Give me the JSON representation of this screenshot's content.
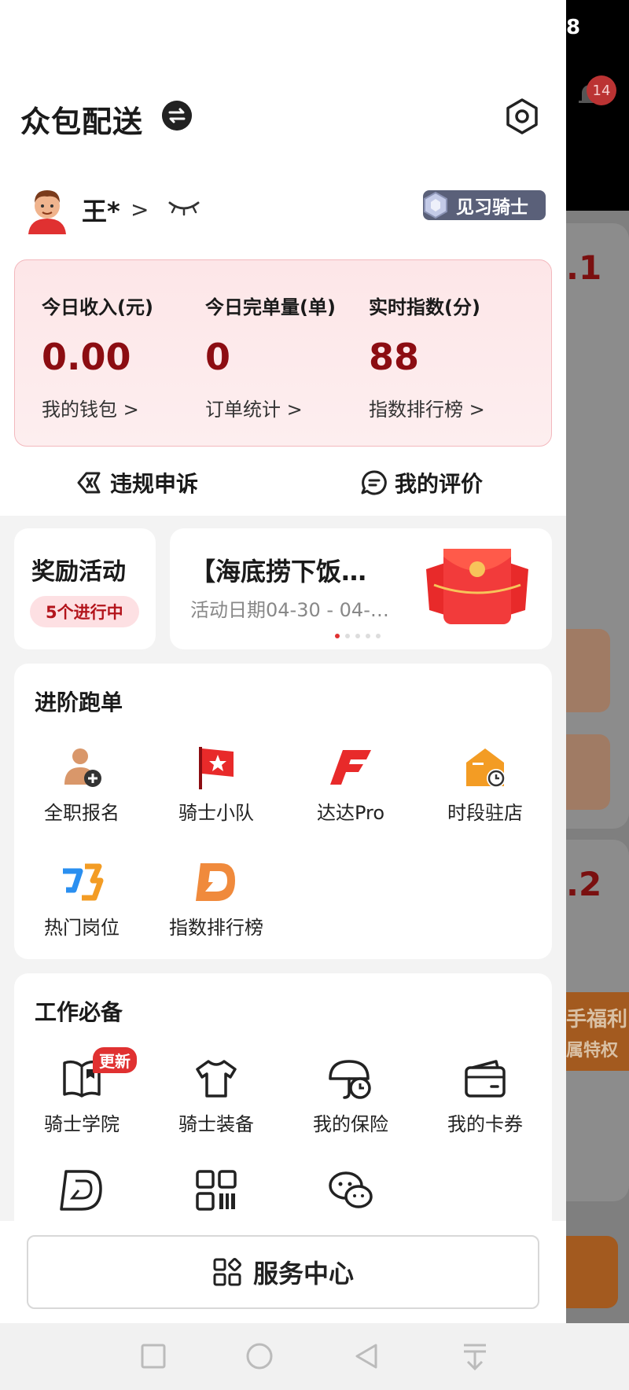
{
  "drawer": {
    "title": "众包配送",
    "user": {
      "name": "王*",
      "chevron": ">",
      "rank": "见习骑士"
    },
    "stats": [
      {
        "label": "今日收入(元)",
        "value": "0.00",
        "link": "我的钱包 >"
      },
      {
        "label": "今日完单量(单)",
        "value": "0",
        "link": "订单统计 >"
      },
      {
        "label": "实时指数(分)",
        "value": "88",
        "link": "指数排行榜 >"
      }
    ],
    "actions": {
      "appeal": "违规申诉",
      "reviews": "我的评价"
    },
    "rewards": {
      "title": "奖励活动",
      "status": "5个进行中"
    },
    "banner": {
      "title": "【海底捞下饭…",
      "date": "活动日期04-30 - 04-…"
    },
    "advanced": {
      "title": "进阶跑单",
      "items": [
        {
          "label": "全职报名",
          "icon": "fulltime-signup-icon"
        },
        {
          "label": "骑士小队",
          "icon": "team-flag-icon"
        },
        {
          "label": "达达Pro",
          "icon": "dada-pro-icon"
        },
        {
          "label": "时段驻店",
          "icon": "store-shift-icon"
        },
        {
          "label": "热门岗位",
          "icon": "hot-jobs-icon"
        },
        {
          "label": "指数排行榜",
          "icon": "index-rank-icon"
        }
      ]
    },
    "essentials": {
      "title": "工作必备",
      "items": [
        {
          "label": "骑士学院",
          "icon": "academy-book-icon",
          "badge": "更新"
        },
        {
          "label": "骑士装备",
          "icon": "tshirt-icon"
        },
        {
          "label": "我的保险",
          "icon": "insurance-umbrella-icon"
        },
        {
          "label": "我的卡券",
          "icon": "wallet-card-icon"
        }
      ]
    },
    "service": {
      "label": "服务中心"
    }
  },
  "background": {
    "status": "8",
    "notifications": "14",
    "value1": ".1",
    "value2": ".2",
    "banner1": "手福利",
    "banner2": "属特权"
  },
  "colors": {
    "primary": "#8c0d12",
    "accent": "#e03131",
    "badge": "#5a6079"
  }
}
